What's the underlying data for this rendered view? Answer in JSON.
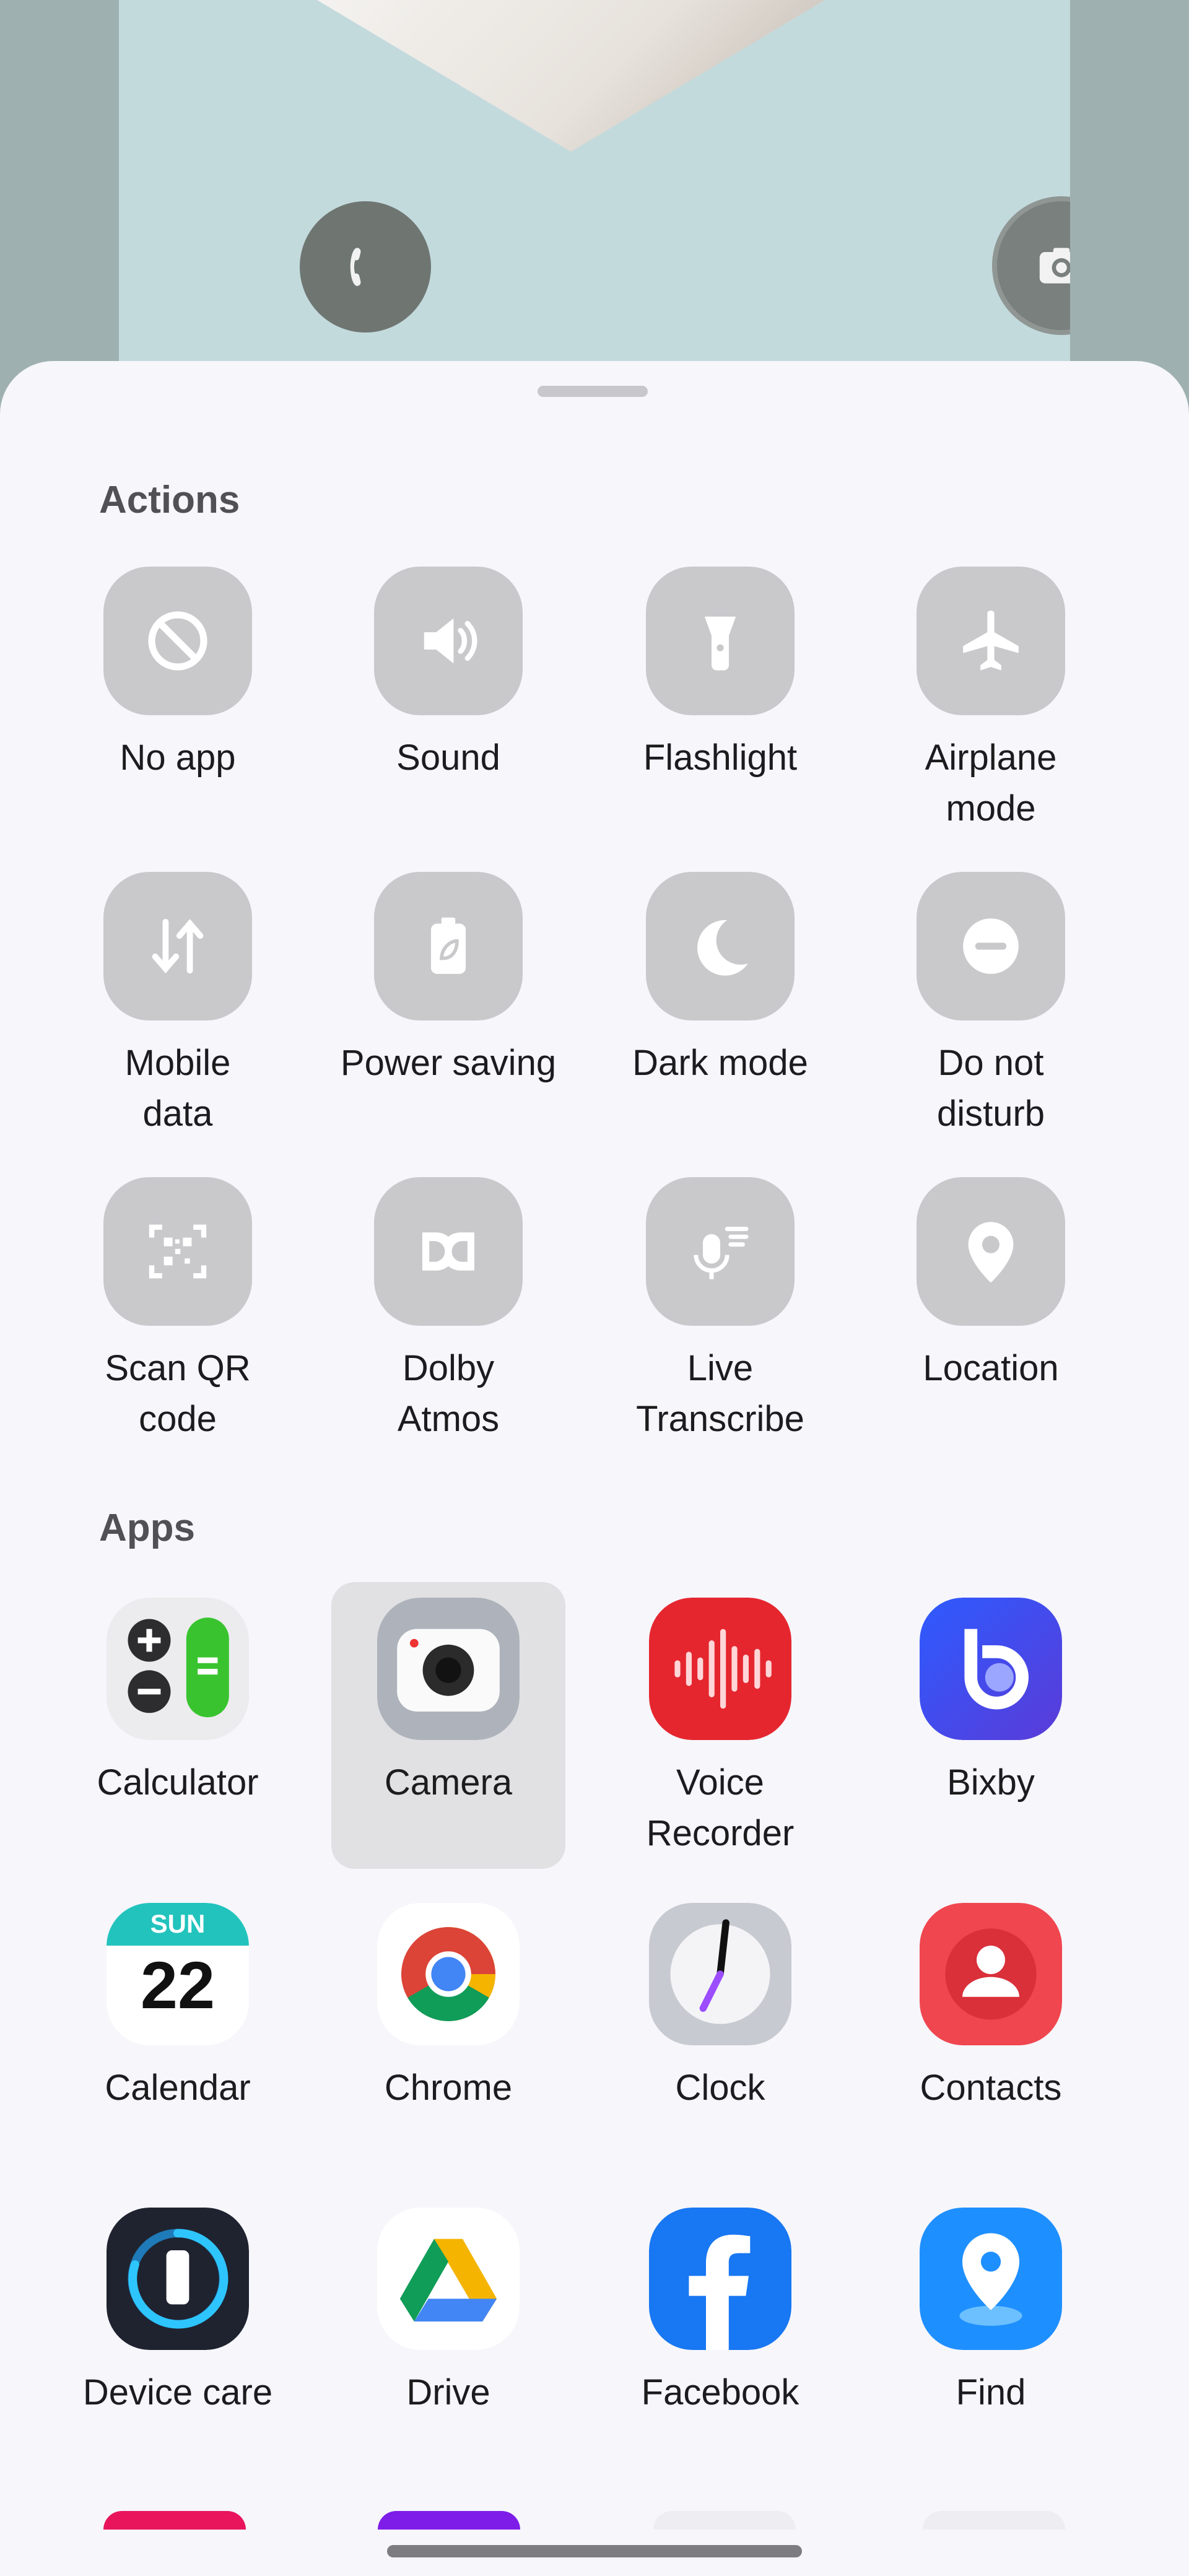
{
  "actions": {
    "title": "Actions",
    "items": [
      {
        "label": "No app",
        "icon": "block-icon"
      },
      {
        "label": "Sound",
        "icon": "speaker-icon"
      },
      {
        "label": "Flashlight",
        "icon": "flashlight-icon"
      },
      {
        "label": "Airplane\nmode",
        "icon": "airplane-icon"
      },
      {
        "label": "Mobile\ndata",
        "icon": "data-arrows-icon"
      },
      {
        "label": "Power saving",
        "icon": "battery-leaf-icon"
      },
      {
        "label": "Dark mode",
        "icon": "moon-icon"
      },
      {
        "label": "Do not\ndisturb",
        "icon": "minus-circle-icon"
      },
      {
        "label": "Scan QR\ncode",
        "icon": "qr-scan-icon"
      },
      {
        "label": "Dolby\nAtmos",
        "icon": "dolby-icon"
      },
      {
        "label": "Live\nTranscribe",
        "icon": "mic-text-icon"
      },
      {
        "label": "Location",
        "icon": "location-pin-icon"
      }
    ]
  },
  "apps": {
    "title": "Apps",
    "items": [
      {
        "label": "Calculator",
        "icon": "calculator-icon"
      },
      {
        "label": "Camera",
        "icon": "camera-icon",
        "selected": true
      },
      {
        "label": "Voice\nRecorder",
        "icon": "voice-recorder-icon"
      },
      {
        "label": "Bixby",
        "icon": "bixby-icon"
      },
      {
        "label": "Calendar",
        "icon": "calendar-icon",
        "badge_day": "SUN",
        "badge_date": "22"
      },
      {
        "label": "Chrome",
        "icon": "chrome-icon"
      },
      {
        "label": "Clock",
        "icon": "clock-icon"
      },
      {
        "label": "Contacts",
        "icon": "contacts-icon"
      },
      {
        "label": "Device care",
        "icon": "device-care-icon"
      },
      {
        "label": "Drive",
        "icon": "drive-icon"
      },
      {
        "label": "Facebook",
        "icon": "facebook-icon"
      },
      {
        "label": "Find",
        "icon": "find-icon"
      }
    ]
  },
  "lock_preview": {
    "left_shortcut_icon": "phone-icon",
    "right_shortcut_icon": "camera-icon"
  },
  "colors": {
    "sheet_bg": "#f6f6fb",
    "action_tile": "#c9c9cc",
    "selected_tile": "#e1e1e4",
    "preview_bg": "#c3dadd"
  }
}
